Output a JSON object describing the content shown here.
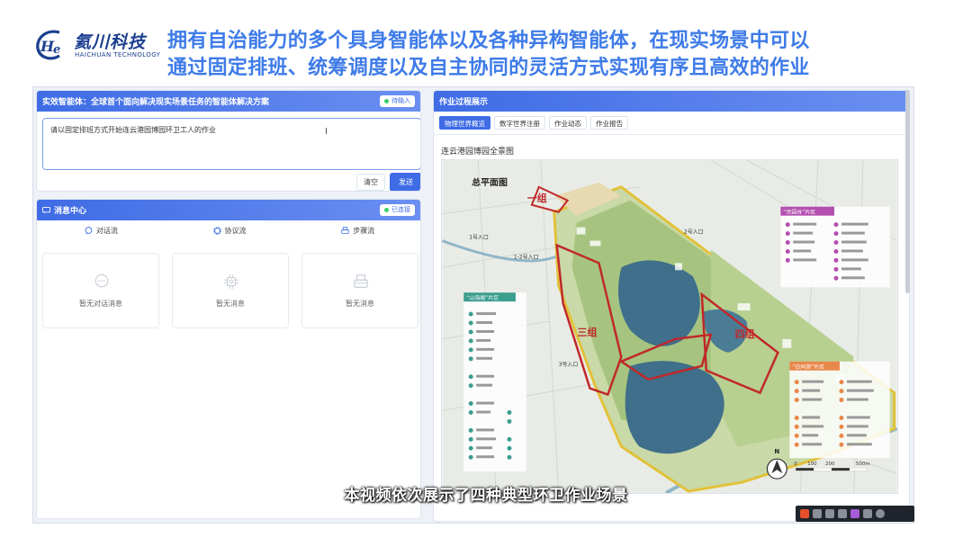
{
  "header": {
    "logo_cn": "氦川科技",
    "logo_en": "HAICHUAN TECHNOLOGY",
    "headline_line1": "拥有自治能力的多个具身智能体以及各种异构智能体，在现实场景中可以",
    "headline_line2": "通过固定排班、统筹调度以及自主协同的灵活方式实现有序且高效的作业",
    "headline_color": "#3e7be8"
  },
  "task_panel": {
    "title": "实效智能体：全球首个面向解决现实场景任务的智能体解决方案",
    "status": "待输入",
    "input_value": "请以固定排班方式开始连云港园博园环卫工人的作业",
    "clear_label": "清空",
    "send_label": "发送"
  },
  "message_center": {
    "title": "消息中心",
    "status": "已连接",
    "columns": [
      {
        "label": "对话流",
        "icon": "chat-icon",
        "empty": "暂无对话消息"
      },
      {
        "label": "协议流",
        "icon": "chip-icon",
        "empty": "暂无消息"
      },
      {
        "label": "步骤流",
        "icon": "printer-icon",
        "empty": "暂无消息"
      }
    ]
  },
  "work_panel": {
    "title": "作业过程展示",
    "tabs": [
      "物理世界概览",
      "数字世界注册",
      "作业动态",
      "作业报告"
    ],
    "active_tab": 0,
    "map_title": "连云港园博园全景图",
    "map": {
      "heading": "总平面图",
      "group1": "一组",
      "group3": "三组",
      "group4": "四组",
      "entrance_1": "1号入口",
      "entrance_1_2": "1-2号入口",
      "entrance_2": "2号入口",
      "entrance_3": "3号入口",
      "north": "N",
      "scale": [
        "0",
        "100",
        "200",
        "500m"
      ],
      "legend_right_top": "“世园谷”片区",
      "legend_left": "“山海阁”片区",
      "legend_right_bottom": "“日间游”片区"
    }
  },
  "subtitle": "本视频依次展示了四种典型环卫作业场景",
  "colors": {
    "accent": "#3f6ce5",
    "connected": "#3ccf6b",
    "map_water": "#3f6f8a",
    "map_boundary": "#c0282a",
    "map_park_edge": "#e2c13a"
  }
}
